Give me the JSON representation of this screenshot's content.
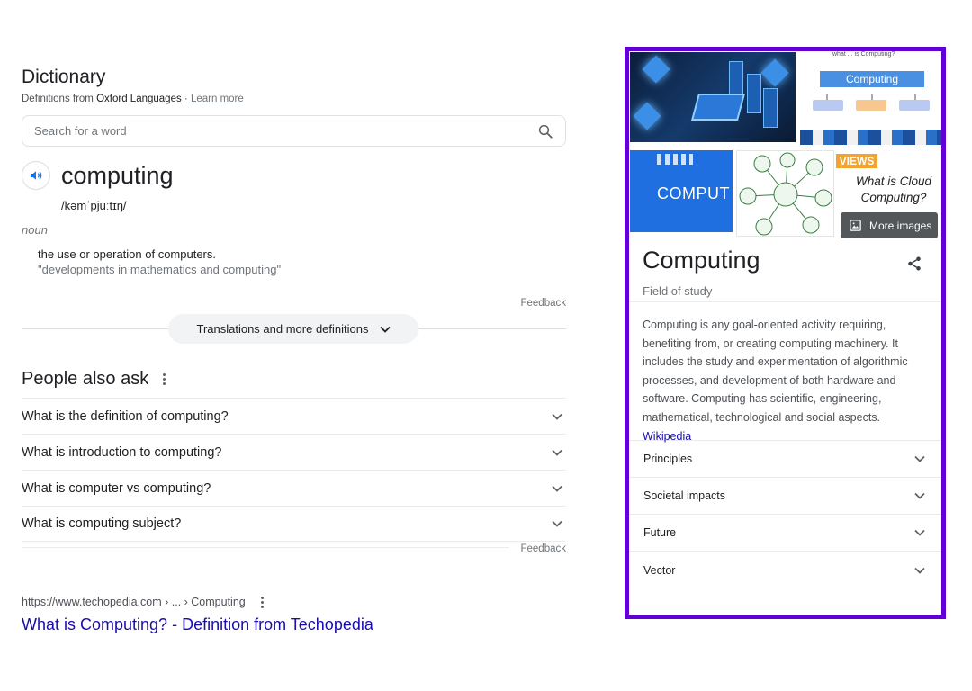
{
  "dictionary": {
    "title": "Dictionary",
    "source_prefix": "Definitions from",
    "source_link": "Oxford Languages",
    "separator": "·",
    "learn_more": "Learn more",
    "search_placeholder": "Search for a word",
    "word": "computing",
    "phonetic": "/kəmˈpjuːtɪŋ/",
    "part_of_speech": "noun",
    "definition": "the use or operation of computers.",
    "example": "\"developments in mathematics and computing\"",
    "feedback": "Feedback",
    "more_definitions": "Translations and more definitions"
  },
  "people_also_ask": {
    "title": "People also ask",
    "questions": [
      "What is the definition of computing?",
      "What is introduction to computing?",
      "What is computer vs computing?",
      "What is computing subject?"
    ],
    "feedback": "Feedback"
  },
  "result": {
    "url": "https://www.techopedia.com › ... › Computing",
    "title": "What is Computing? - Definition from Techopedia"
  },
  "knowledge_panel": {
    "border_color": "#6200d3",
    "images": {
      "diagram_caption": "what ... is Computing?",
      "diagram_label": "Computing",
      "comput_text": "COMPUT",
      "views_text": "VIEWS",
      "cloud_text": "What is Cloud Computing?",
      "more_images": "More images"
    },
    "title": "Computing",
    "subtitle": "Field of study",
    "description": "Computing is any goal-oriented activity requiring, benefiting from, or creating computing machinery. It includes the study and experimentation of algorithmic processes, and development of both hardware and software. Computing has scientific, engineering, mathematical, technological and social aspects.",
    "source": "Wikipedia",
    "sections": [
      "Principles",
      "Societal impacts",
      "Future",
      "Vector"
    ]
  },
  "colors": {
    "link_blue": "#1a0dab",
    "text": "#202124",
    "muted": "#70757a",
    "accent_purple": "#6200d3"
  },
  "icons": [
    "search-icon",
    "speaker-icon",
    "chevron-down-icon",
    "more-vert-icon",
    "image-icon",
    "share-icon"
  ]
}
